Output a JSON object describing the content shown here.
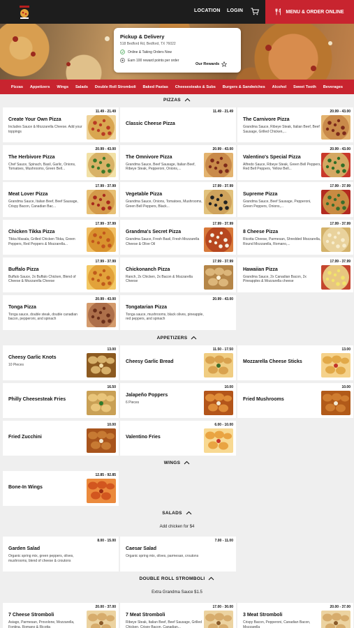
{
  "header": {
    "location_label": "LOCATION",
    "login_label": "LOGIN",
    "order_button_label": "MENU & ORDER ONLINE"
  },
  "pickup": {
    "title": "Pickup & Delivery",
    "address": "518 Bedford Rd, Bedford, TX 76022",
    "status": "Online & Taking Orders Now",
    "reward_text": "Earn 100 reward points per order",
    "rewards_link": "Our Rewards"
  },
  "categories": [
    "Pizzas",
    "Appetizers",
    "Wings",
    "Salads",
    "Double Roll Stromboli",
    "Baked Pastas",
    "Cheesesteaks & Subs",
    "Burgers & Sandwiches",
    "Alcohol",
    "Sweet Tooth",
    "Beverages"
  ],
  "sections": {
    "pizzas": {
      "title": "PIZZAS",
      "items": [
        {
          "name": "Create Your Own Pizza",
          "desc": "Includes Sauce & Mozzarella Cheese. Add your toppings",
          "price": "11.49 - 21.49"
        },
        {
          "name": "Classic Cheese Pizza",
          "desc": "",
          "price": "11.49 - 21.49"
        },
        {
          "name": "The Carnivore Pizza",
          "desc": "Grandma Sauce, Ribeye Steak, Italian Beef, Beef Sausage, Grilled Chicken,...",
          "price": "20.99 - 43.00"
        },
        {
          "name": "The Herbivore Pizza",
          "desc": "Chef Sauce, Spinach, Basil, Garlic, Onions, Tomatoes, Mushrooms, Green Bell...",
          "price": "20.99 - 43.00"
        },
        {
          "name": "The Omnivore Pizza",
          "desc": "Grandma Sauce, Beef Sausage, Italian Beef, Ribeye Steak, Pepperoni, Onions,...",
          "price": "20.99 - 43.00"
        },
        {
          "name": "Valentino's Special Pizza",
          "desc": "Alfredo Sauce, Ribeye Steak, Green Bell Peppers, Red Bell Peppers, Yellow Bell...",
          "price": "20.99 - 43.00"
        },
        {
          "name": "Meat Lover Pizza",
          "desc": "Grandma Sauce, Italian Beef, Beef Sausage, Crispy Bacon, Canadian Bac...",
          "price": "17.99 - 37.99"
        },
        {
          "name": "Vegetable Pizza",
          "desc": "Grandma Sauce, Onions, Tomatoes, Mushrooms, Green Bell Peppers, Black...",
          "price": "17.99 - 37.99"
        },
        {
          "name": "Supreme Pizza",
          "desc": "Grandma Sauce, Beef Sausage, Pepperoni, Green Peppers, Onions,...",
          "price": "17.99 - 37.99"
        },
        {
          "name": "Chicken Tikka Pizza",
          "desc": "Tikka Masala, Grilled Chicken Tikka, Green Peppers, Red Peppers & Mozzarella...",
          "price": "17.99 - 37.99"
        },
        {
          "name": "Grandma's Secret Pizza",
          "desc": "Grandma Sauce, Fresh Basil, Fresh Mozzarella Cheese & Olive Oil",
          "price": "17.99 - 37.99"
        },
        {
          "name": "8 Cheese Pizza",
          "desc": "Ricotta Cheese, Parmesan, Shredded Mozzarella, Round Mozzarella, Romano,...",
          "price": "17.99 - 37.99"
        },
        {
          "name": "Buffalo Pizza",
          "desc": "Buffalo Sauce, 2x Buffalo Chicken, Blend of Cheese & Mozzarella Cheese",
          "price": "17.99 - 37.99"
        },
        {
          "name": "Chickonanch Pizza",
          "desc": "Ranch, 2x Chicken, 2x Bacon & Mozzarella Cheese",
          "price": "17.99 - 37.99"
        },
        {
          "name": "Hawaiian Pizza",
          "desc": "Grandma Sauce, 2x Canadian Bacon, 2x Pineapples & Mozzarella cheese",
          "price": "17.99 - 37.99"
        },
        {
          "name": "Tonga Pizza",
          "desc": "Tonga sauce, double steak, double canadian bacon, pepperoni, and spinach",
          "price": "20.99 - 43.00"
        },
        {
          "name": "Tongatarian Pizza",
          "desc": "Tonga sauce, mushrooms, black olives, pineapple, red peppers, and spinach",
          "price": "20.99 - 43.00"
        }
      ]
    },
    "appetizers": {
      "title": "APPETIZERS",
      "items": [
        {
          "name": "Cheesy Garlic Knots",
          "desc": "10 Pieces",
          "price": "13.00"
        },
        {
          "name": "Cheesy Garlic Bread",
          "desc": "",
          "price": "11.50 - 17.50"
        },
        {
          "name": "Mozzarella Cheese Sticks",
          "desc": "",
          "price": "13.00"
        },
        {
          "name": "Philly Cheesesteak Fries",
          "desc": "",
          "price": "16.50"
        },
        {
          "name": "Jalapeño Poppers",
          "desc": "6 Pieces",
          "price": "10.00"
        },
        {
          "name": "Fried Mushrooms",
          "desc": "",
          "price": "10.00"
        },
        {
          "name": "Fried Zucchini",
          "desc": "",
          "price": "10.00"
        },
        {
          "name": "Valentino Fries",
          "desc": "",
          "price": "6.00 - 10.00"
        }
      ]
    },
    "wings": {
      "title": "WINGS",
      "items": [
        {
          "name": "Bone-In Wings",
          "desc": "",
          "price": "12.85 - 92.85"
        }
      ]
    },
    "salads": {
      "title": "SALADS",
      "note": "Add chicken for $4",
      "items": [
        {
          "name": "Garden Salad",
          "desc": "Organic spring mix, green peppers, olives, mushrooms, blend of cheese & croutons",
          "price": "8.00 - 15.00"
        },
        {
          "name": "Caesar Salad",
          "desc": "Organic spring mix, olives, parmesan, croutons",
          "price": "7.00 - 11.00"
        }
      ]
    },
    "stromboli": {
      "title": "DOUBLE ROLL STROMBOLI",
      "note": "Extra Grandma Sauce $1.5",
      "items": [
        {
          "name": "7 Cheese Stromboli",
          "desc": "Asiago, Parmesan, Provolone, Mozzarella, Fontina, Romano & Ricotta",
          "price": "20.00 - 37.00"
        },
        {
          "name": "7 Meat Stromboli",
          "desc": "Ribeye Steak, Italian Beef, Beef Sausage, Grilled Chicken, Crispy Bacon, Canadian...",
          "price": "17.00 - 30.00"
        },
        {
          "name": "3 Meat Stromboli",
          "desc": "Crispy Bacon, Pepperoni, Canadian Bacon, Mozzarella",
          "price": "20.00 - 37.00"
        }
      ]
    }
  }
}
